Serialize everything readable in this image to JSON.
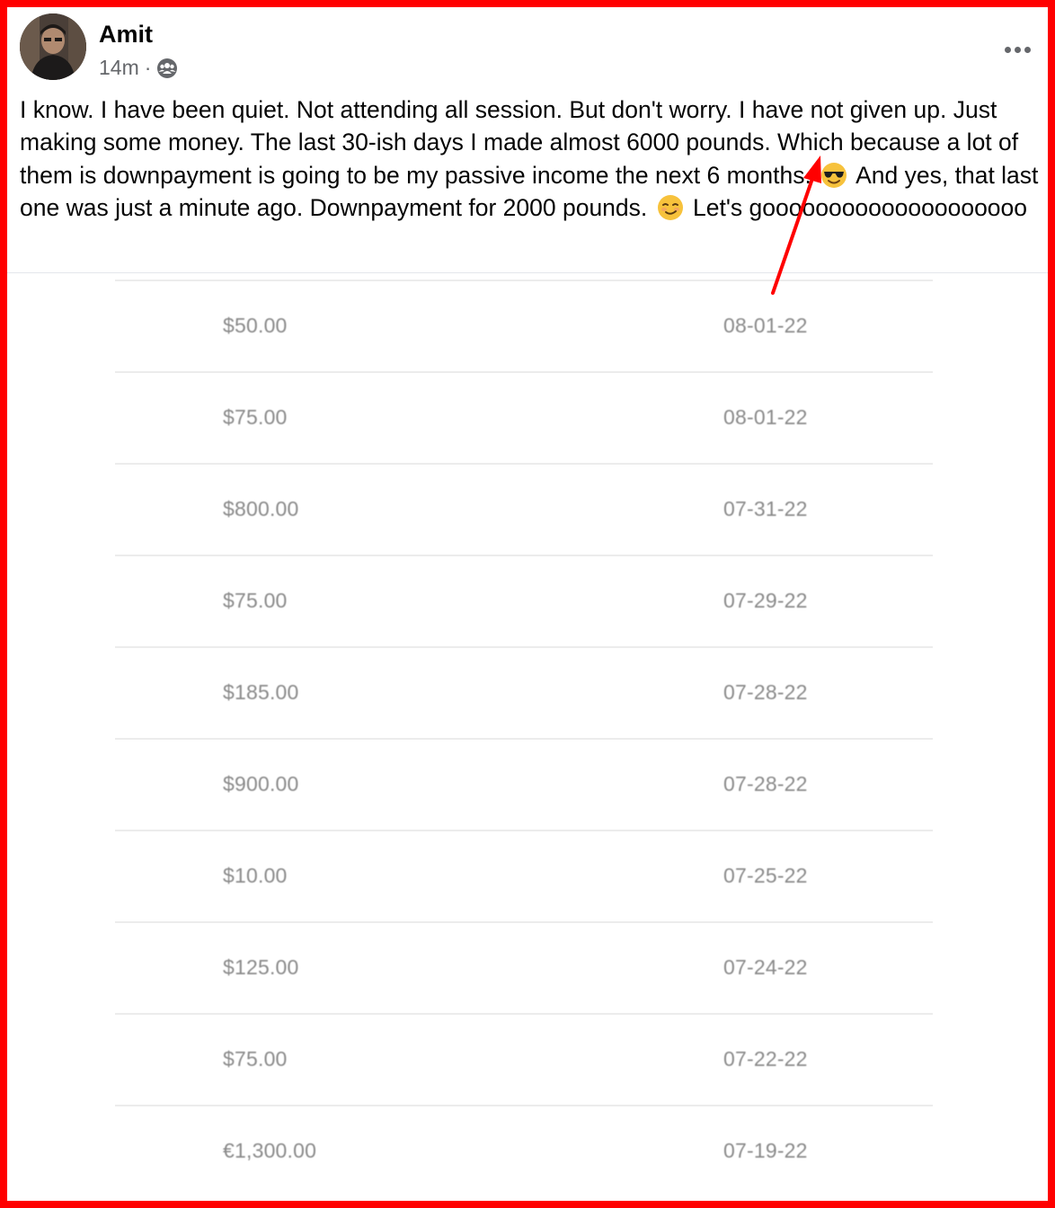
{
  "post": {
    "author": "Amit",
    "time": "14m",
    "separator": "·",
    "audience_icon": "group-audience-icon",
    "more_icon": "more-options-icon",
    "text_part1": "I know. I have been quiet. Not attending all session. But don't worry. I have not given up. Just making some money. The last 30-ish days I made almost 6000 pounds. Which because a lot of them is downpayment is going to be my passive income the next 6 months.",
    "emoji1": "smiling-face-with-sunglasses-emoji",
    "text_part2": " And yes, that last one was just a minute ago. Downpayment for 2000 pounds.",
    "emoji2": "smirking-face-emoji",
    "text_part3": "  Let's goooooooooooooooooooo"
  },
  "payments": [
    {
      "amount": "$50.00",
      "date": "08-01-22"
    },
    {
      "amount": "$75.00",
      "date": "08-01-22"
    },
    {
      "amount": "$800.00",
      "date": "07-31-22"
    },
    {
      "amount": "$75.00",
      "date": "07-29-22"
    },
    {
      "amount": "$185.00",
      "date": "07-28-22"
    },
    {
      "amount": "$900.00",
      "date": "07-28-22"
    },
    {
      "amount": "$10.00",
      "date": "07-25-22"
    },
    {
      "amount": "$125.00",
      "date": "07-24-22"
    },
    {
      "amount": "$75.00",
      "date": "07-22-22"
    },
    {
      "amount": "€1,300.00",
      "date": "07-19-22"
    }
  ],
  "colors": {
    "frame_border": "#ff0000",
    "annotation_arrow": "#ff0000",
    "text_primary": "#050505",
    "text_secondary": "#65676b",
    "payment_text": "#8a8a8a"
  }
}
